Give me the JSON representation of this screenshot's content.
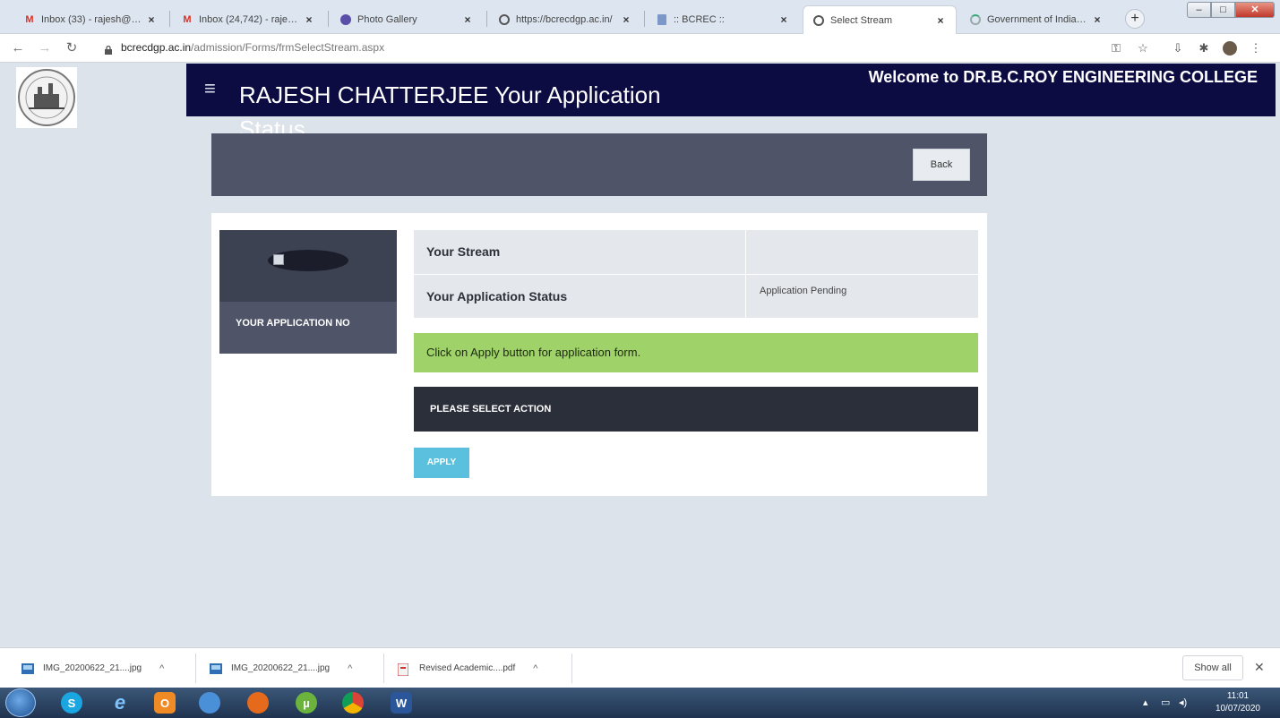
{
  "browser": {
    "tabs": [
      {
        "title": "Inbox (33) - rajesh@bo",
        "icon": "gmail-icon",
        "active": false
      },
      {
        "title": "Inbox (24,742) - rajesh.",
        "icon": "gmail-icon",
        "active": false
      },
      {
        "title": "Photo Gallery",
        "icon": "gallery-icon",
        "active": false
      },
      {
        "title": "https://bcrecdgp.ac.in/",
        "icon": "globe-icon",
        "active": false
      },
      {
        "title": ":: BCREC ::",
        "icon": "doc-icon",
        "active": false
      },
      {
        "title": "Select Stream",
        "icon": "globe-icon",
        "active": true
      },
      {
        "title": "Government of India, A",
        "icon": "loading-icon",
        "active": false
      }
    ],
    "new_tab_label": "+",
    "url_host": "bcrecdgp.ac.in",
    "url_path": "/admission/Forms/frmSelectStream.aspx"
  },
  "header": {
    "logo": "college-seal-logo",
    "menu_icon": "≡",
    "title": "RAJESH CHATTERJEE Your Application Status",
    "welcome": "Welcome to DR.B.C.ROY ENGINEERING COLLEGE"
  },
  "toolbar": {
    "back_label": "Back"
  },
  "profile": {
    "application_no_label": "YOUR APPLICATION NO"
  },
  "details": {
    "rows": [
      {
        "label": "Your Stream",
        "value": ""
      },
      {
        "label": "Your Application Status",
        "value": "Application Pending"
      }
    ]
  },
  "notice": {
    "text": "Click on Apply button for application form."
  },
  "action": {
    "heading": "PLEASE SELECT ACTION",
    "apply_label": "APPLY"
  },
  "downloads": {
    "items": [
      {
        "name": "IMG_20200622_21....jpg",
        "icon": "image-file-icon"
      },
      {
        "name": "IMG_20200622_21....jpg",
        "icon": "image-file-icon"
      },
      {
        "name": "Revised Academic....pdf",
        "icon": "pdf-file-icon"
      }
    ],
    "show_all_label": "Show all"
  },
  "taskbar": {
    "apps": [
      "skype-icon",
      "internet-explorer-icon",
      "outlook-icon",
      "chromium-icon",
      "firefox-icon",
      "utorrent-icon",
      "chrome-icon",
      "word-icon"
    ],
    "time": "11:01",
    "date": "10/07/2020"
  },
  "colors": {
    "nav_bg": "#0c0c42",
    "panel_bg": "#4f5468",
    "notice_bg": "#9fd36a",
    "action_bg": "#2b2f3a",
    "apply_bg": "#5bc0de",
    "page_bg": "#dde3ea"
  }
}
